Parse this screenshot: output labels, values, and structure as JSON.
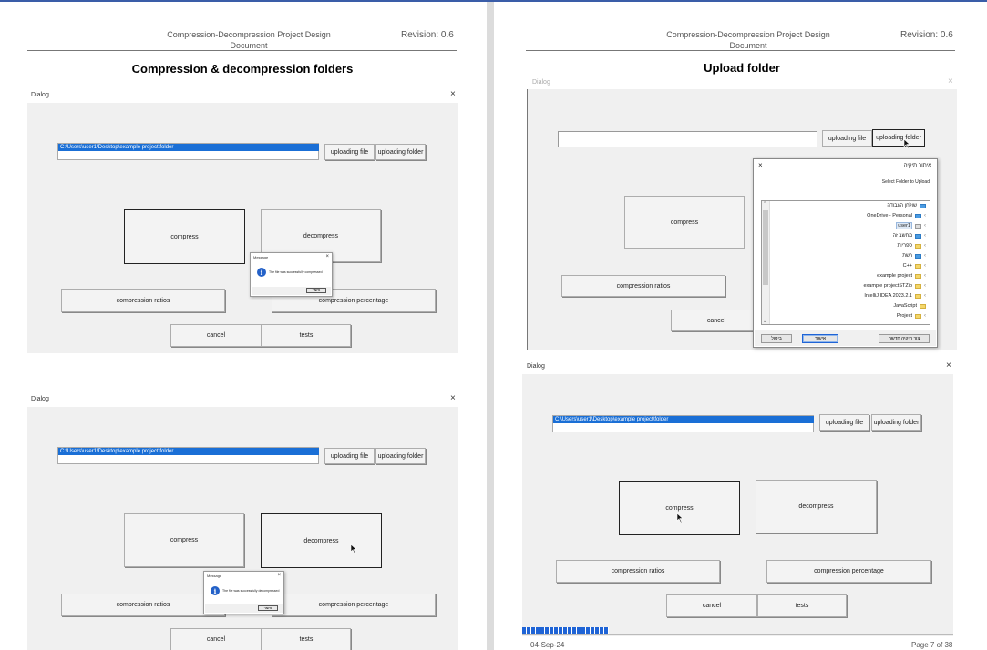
{
  "document": {
    "header_title": "Compression-Decompression Project Design Document",
    "revision": "Revision: 0.6",
    "footer_date": "04-Sep-24",
    "footer_page": "Page 7 of 38"
  },
  "left_page": {
    "section_title": "Compression & decompression folders",
    "dialog1": {
      "title": "Dialog",
      "close": "×",
      "path_value": "C:\\Users\\user1\\Desktop\\example project\\folder",
      "upload_file": "uploading file",
      "upload_folder": "uploading folder",
      "compress": "compress",
      "decompress": "decompress",
      "compression_ratios": "compression ratios",
      "compression_percentage": "compression percentage",
      "cancel": "cancel",
      "tests": "tests",
      "message": {
        "title": "Message",
        "close": "×",
        "icon": "i",
        "text": "The file was successfully compressed",
        "ok": "אישור"
      }
    },
    "dialog2": {
      "title": "Dialog",
      "close": "×",
      "path_value": "C:\\Users\\user1\\Desktop\\example project\\folder",
      "upload_file": "uploading file",
      "upload_folder": "uploading folder",
      "compress": "compress",
      "decompress": "decompress",
      "compression_ratios": "compression ratios",
      "compression_percentage": "compression percentage",
      "cancel": "cancel",
      "tests": "tests",
      "message": {
        "title": "Message",
        "close": "×",
        "icon": "i",
        "text": "The file was successfully decompressed",
        "ok": "אישור"
      }
    }
  },
  "right_page": {
    "section_title": "Upload folder",
    "dialog_upload": {
      "title": "Dialog",
      "close": "×",
      "upload_file": "uploading file",
      "upload_folder": "uploading folder",
      "compress": "compress",
      "compression_ratios": "compression ratios",
      "cancel": "cancel",
      "picker": {
        "title": "איתור תיקיה",
        "close": "×",
        "subtitle": "Select Folder to Upload",
        "items": [
          {
            "label": "שולחן העבודה",
            "icon": "blue"
          },
          {
            "label": "OneDrive - Personal",
            "icon": "blue"
          },
          {
            "label": "user1",
            "icon": "user",
            "selected": true
          },
          {
            "label": "מחשב זה",
            "icon": "blue"
          },
          {
            "label": "ספריות",
            "icon": "yellow"
          },
          {
            "label": "רשת",
            "icon": "blue"
          },
          {
            "label": "C++",
            "icon": "yellow"
          },
          {
            "label": "example project",
            "icon": "yellow"
          },
          {
            "label": "example projectSTZip",
            "icon": "yellow"
          },
          {
            "label": "IntelliJ IDEA 2023.2.1",
            "icon": "yellow"
          },
          {
            "label": "JavaScript",
            "icon": "yellow"
          },
          {
            "label": "Project",
            "icon": "yellow"
          }
        ],
        "new_folder": "צור תיקיה חדשה",
        "ok": "אישור",
        "cancel": "ביטול"
      }
    },
    "dialog_progress": {
      "title": "Dialog",
      "close": "×",
      "path_value": "C:\\Users\\user1\\Desktop\\example project\\folder",
      "upload_file": "uploading file",
      "upload_folder": "uploading folder",
      "compress": "compress",
      "decompress": "decompress",
      "compression_ratios": "compression ratios",
      "compression_percentage": "compression percentage",
      "cancel": "cancel",
      "tests": "tests",
      "progress_fraction": 0.2
    }
  }
}
